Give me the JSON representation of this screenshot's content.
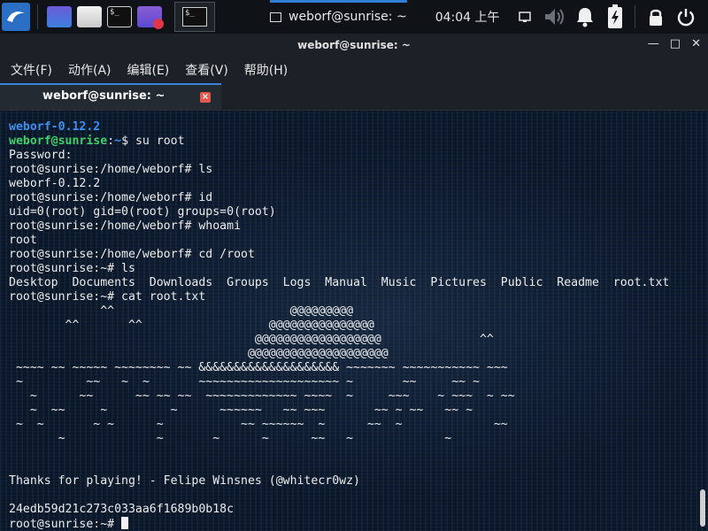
{
  "panel": {
    "icons": [
      "kali-menu-icon",
      "show-desktop-icon",
      "file-manager-icon",
      "terminal-icon",
      "screen-recorder-icon"
    ],
    "terminal_icon_glyph": "$_",
    "task_title": "weborf@sunrise: ~",
    "clock": "04:04 上午",
    "tray_icons": [
      "window-list-icon",
      "volume-icon",
      "notification-bell-icon",
      "battery-icon",
      "lock-icon",
      "power-icon"
    ]
  },
  "window": {
    "title": "weborf@sunrise: ~",
    "controls": [
      "minimize",
      "maximize",
      "close"
    ]
  },
  "menubar": {
    "items": [
      "文件(F)",
      "动作(A)",
      "编辑(E)",
      "查看(V)",
      "帮助(H)"
    ]
  },
  "tab": {
    "label": "weborf@sunrise: ~",
    "close_glyph": "×"
  },
  "terminal": {
    "lines": [
      [
        {
          "t": "weborf-0.12.2",
          "c": "blue"
        }
      ],
      [
        {
          "t": "weborf@sunrise",
          "c": "green"
        },
        {
          "t": ":",
          "c": ""
        },
        {
          "t": "~",
          "c": "blue"
        },
        {
          "t": "$ su root",
          "c": ""
        }
      ],
      [
        {
          "t": "Password:",
          "c": ""
        }
      ],
      [
        {
          "t": "root@sunrise:/home/weborf# ls",
          "c": ""
        }
      ],
      [
        {
          "t": "weborf-0.12.2",
          "c": ""
        }
      ],
      [
        {
          "t": "root@sunrise:/home/weborf# id",
          "c": ""
        }
      ],
      [
        {
          "t": "uid=0(root) gid=0(root) groups=0(root)",
          "c": ""
        }
      ],
      [
        {
          "t": "root@sunrise:/home/weborf# whoami",
          "c": ""
        }
      ],
      [
        {
          "t": "root",
          "c": ""
        }
      ],
      [
        {
          "t": "root@sunrise:/home/weborf# cd /root",
          "c": ""
        }
      ],
      [
        {
          "t": "root@sunrise:~# ls",
          "c": ""
        }
      ],
      [
        {
          "t": "Desktop  Documents  Downloads  Groups  Logs  Manual  Music  Pictures  Public  Readme  root.txt",
          "c": ""
        }
      ],
      [
        {
          "t": "root@sunrise:~# cat root.txt",
          "c": ""
        }
      ],
      [
        {
          "t": "             ^^                         @@@@@@@@@",
          "c": ""
        }
      ],
      [
        {
          "t": "        ^^       ^^                  @@@@@@@@@@@@@@@",
          "c": ""
        }
      ],
      [
        {
          "t": "                                   @@@@@@@@@@@@@@@@@@              ^^",
          "c": ""
        }
      ],
      [
        {
          "t": "                                  @@@@@@@@@@@@@@@@@@@@",
          "c": ""
        }
      ],
      [
        {
          "t": " ~~~~ ~~ ~~~~~ ~~~~~~~~ ~~ &&&&&&&&&&&&&&&&&&&& ~~~~~~~ ~~~~~~~~~~~ ~~~",
          "c": ""
        }
      ],
      [
        {
          "t": " ~         ~~   ~  ~       ~~~~~~~~~~~~~~~~~~~~ ~       ~~     ~~ ~",
          "c": ""
        }
      ],
      [
        {
          "t": "   ~      ~~      ~~ ~~ ~~  ~~~~~~~~~~~~~ ~~~~  ~     ~~~    ~ ~~~  ~ ~~",
          "c": ""
        }
      ],
      [
        {
          "t": "   ~  ~~     ~         ~      ~~~~~~   ~~ ~~~       ~~ ~ ~~   ~~ ~",
          "c": ""
        }
      ],
      [
        {
          "t": " ~  ~       ~ ~      ~           ~~ ~~~~~~  ~      ~~  ~             ~~",
          "c": ""
        }
      ],
      [
        {
          "t": "       ~             ~       ~      ~      ~~   ~             ~",
          "c": ""
        }
      ],
      [
        {
          "t": "",
          "c": ""
        }
      ],
      [
        {
          "t": "",
          "c": ""
        }
      ],
      [
        {
          "t": "Thanks for playing! - Felipe Winsnes (@whitecr0wz)",
          "c": ""
        }
      ],
      [
        {
          "t": "",
          "c": ""
        }
      ],
      [
        {
          "t": "24edb59d21c273c033aa6f1689b0b18c",
          "c": ""
        }
      ],
      [
        {
          "t": "root@sunrise:~# ",
          "c": "",
          "cursor": true
        }
      ]
    ]
  },
  "colors": {
    "prompt_user": "#3fd06a",
    "path_blue": "#3f8ff0",
    "accent": "#2f7fd6",
    "tab_close": "#e2584a"
  }
}
